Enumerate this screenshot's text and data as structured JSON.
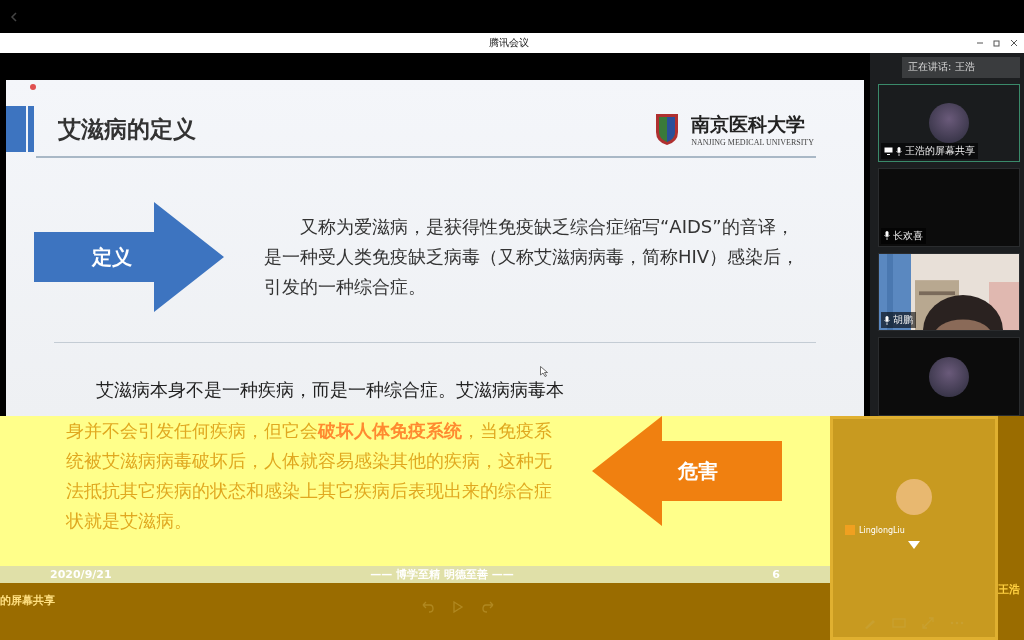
{
  "window": {
    "title": "腾讯会议"
  },
  "slide": {
    "title": "艾滋病的定义",
    "logo_name": "南京医科大学",
    "logo_subtitle": "NANJING MEDICAL UNIVERSITY",
    "definition": {
      "label": "定义",
      "text": "又称为爱滋病，是获得性免疫缺乏综合症缩写“AIDS”的音译，是一种受人类免疫缺乏病毒（又称艾滋病病毒，简称HIV）感染后，引发的一种综合症。"
    },
    "harm": {
      "label": "危害",
      "text_top": "艾滋病本身不是一种疾病，而是一种综合症。艾滋病病毒本",
      "text_bottom": "身并不会引发任何疾病，但它会**破坏人体免疫系统**，当免疫系统被艾滋病病毒破坏后，人体就容易感染其他的疾病，这种无法抵抗其它疾病的状态和感染上其它疾病后表现出来的综合症状就是艾滋病。"
    },
    "footer": {
      "date": "2020/9/21",
      "motto": "——  博学至精  明德至善  ——",
      "page": "6"
    }
  },
  "speaking": "正在讲话: 王浩",
  "participants": [
    {
      "name": "王浩的屏幕共享",
      "kind": "avatar",
      "sharing": true
    },
    {
      "name": "长欢喜",
      "kind": "blank"
    },
    {
      "name": "胡鹏",
      "kind": "camera"
    },
    {
      "kind": "avatar"
    }
  ],
  "overlay_panel": {
    "user": "LinglongLiu",
    "speaker": "王浩"
  },
  "share_label": "的屏幕共享"
}
